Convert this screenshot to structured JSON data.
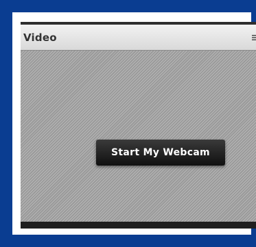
{
  "page": {
    "background_color": "#0a3d91"
  },
  "video_pod": {
    "title": "Video",
    "menu_icon": "menu-lines-icon",
    "start_webcam_label": "Start My Webcam"
  }
}
